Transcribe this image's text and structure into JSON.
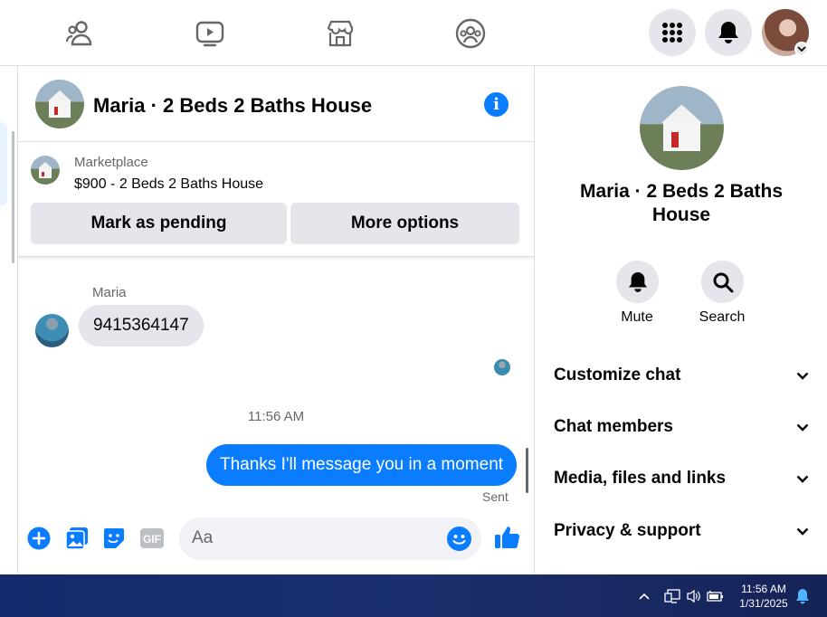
{
  "topnav": {
    "icons": [
      "friends-icon",
      "watch-icon",
      "marketplace-icon",
      "groups-icon"
    ],
    "right_icons": [
      "menu-grid-icon",
      "notifications-bell-icon",
      "profile-avatar"
    ]
  },
  "chat": {
    "title": "Maria · 2 Beds 2 Baths House",
    "marketplace": {
      "label": "Marketplace",
      "item": "$900 - 2 Beds 2 Baths House",
      "mark_pending": "Mark as pending",
      "more_options": "More options"
    },
    "messages": {
      "sender_name": "Maria",
      "incoming_text": "9415364147",
      "timestamp": "11:56 AM",
      "outgoing_text": "Thanks I'll message you in a moment",
      "status": "Sent"
    },
    "composer": {
      "placeholder": "Aa",
      "value": "",
      "icons": [
        "add-icon",
        "photo-icon",
        "sticker-icon",
        "gif-icon",
        "emoji-icon",
        "like-icon"
      ],
      "gif_label": "GIF"
    }
  },
  "details": {
    "title": "Maria · 2 Beds 2 Baths House",
    "actions": [
      {
        "label": "Mute",
        "icon": "bell-icon"
      },
      {
        "label": "Search",
        "icon": "search-icon"
      }
    ],
    "sections": [
      "Customize chat",
      "Chat members",
      "Media, files and links",
      "Privacy & support"
    ]
  },
  "taskbar": {
    "time": "11:56 AM",
    "date": "1/31/2025"
  },
  "colors": {
    "accent": "#0a7cff",
    "bubble_gray": "#e4e6eb",
    "text_secondary": "#65676b"
  }
}
